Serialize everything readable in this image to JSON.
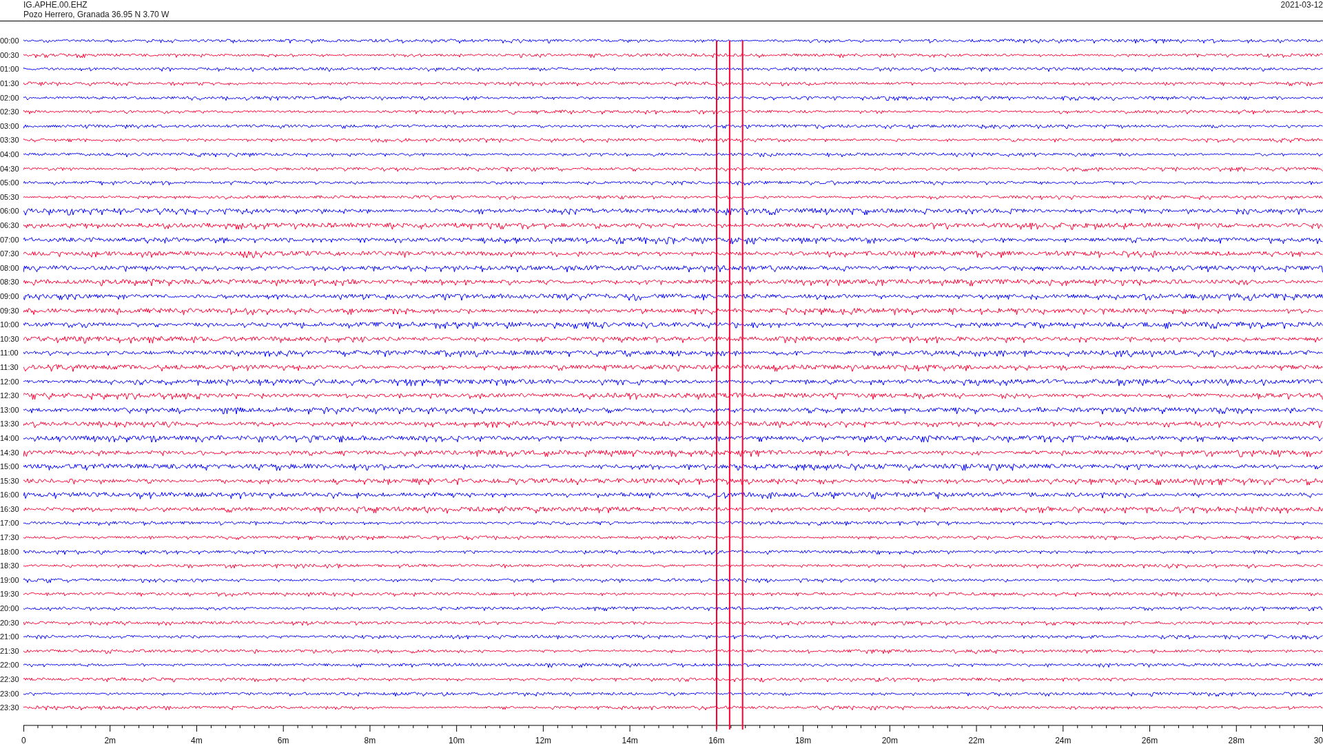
{
  "header": {
    "station": "IG.APHE.00.EHZ",
    "location": "Pozo Herrero, Granada  36.95 N 3.70 W",
    "date": "2021-03-12"
  },
  "rows": [
    {
      "label": "00:00",
      "color": "#0000ff"
    },
    {
      "label": "00:30",
      "color": "#ff0033"
    },
    {
      "label": "01:00",
      "color": "#0000ff"
    },
    {
      "label": "01:30",
      "color": "#ff0033"
    },
    {
      "label": "02:00",
      "color": "#0000ff"
    },
    {
      "label": "02:30",
      "color": "#ff0033"
    },
    {
      "label": "03:00",
      "color": "#0000ff"
    },
    {
      "label": "03:30",
      "color": "#ff0033"
    },
    {
      "label": "04:00",
      "color": "#0000ff"
    },
    {
      "label": "04:30",
      "color": "#ff0033"
    },
    {
      "label": "05:00",
      "color": "#0000ff"
    },
    {
      "label": "05:30",
      "color": "#ff0033"
    },
    {
      "label": "06:00",
      "color": "#0000ff"
    },
    {
      "label": "06:30",
      "color": "#ff0033"
    },
    {
      "label": "07:00",
      "color": "#0000ff"
    },
    {
      "label": "07:30",
      "color": "#ff0033"
    },
    {
      "label": "08:00",
      "color": "#0000ff"
    },
    {
      "label": "08:30",
      "color": "#ff0033"
    },
    {
      "label": "09:00",
      "color": "#0000ff"
    },
    {
      "label": "09:30",
      "color": "#ff0033"
    },
    {
      "label": "10:00",
      "color": "#0000ff"
    },
    {
      "label": "10:30",
      "color": "#ff0033"
    },
    {
      "label": "11:00",
      "color": "#0000ff"
    },
    {
      "label": "11:30",
      "color": "#ff0033"
    },
    {
      "label": "12:00",
      "color": "#0000ff"
    },
    {
      "label": "12:30",
      "color": "#ff0033"
    },
    {
      "label": "13:00",
      "color": "#0000ff"
    },
    {
      "label": "13:30",
      "color": "#ff0033"
    },
    {
      "label": "14:00",
      "color": "#0000ff"
    },
    {
      "label": "14:30",
      "color": "#ff0033"
    },
    {
      "label": "15:00",
      "color": "#0000ff"
    },
    {
      "label": "15:30",
      "color": "#ff0033"
    },
    {
      "label": "16:00",
      "color": "#0000ff"
    },
    {
      "label": "16:30",
      "color": "#ff0033"
    },
    {
      "label": "17:00",
      "color": "#0000ff"
    },
    {
      "label": "17:30",
      "color": "#ff0033"
    },
    {
      "label": "18:00",
      "color": "#0000ff"
    },
    {
      "label": "18:30",
      "color": "#ff0033"
    },
    {
      "label": "19:00",
      "color": "#0000ff"
    },
    {
      "label": "19:30",
      "color": "#ff0033"
    },
    {
      "label": "20:00",
      "color": "#0000ff"
    },
    {
      "label": "20:30",
      "color": "#ff0033"
    },
    {
      "label": "21:00",
      "color": "#0000ff"
    },
    {
      "label": "21:30",
      "color": "#ff0033"
    },
    {
      "label": "22:00",
      "color": "#0000ff"
    },
    {
      "label": "22:30",
      "color": "#ff0033"
    },
    {
      "label": "23:00",
      "color": "#0000ff"
    },
    {
      "label": "23:30",
      "color": "#ff0033"
    }
  ],
  "x_axis": {
    "ticks": [
      "0",
      "2m",
      "4m",
      "6m",
      "8m",
      "10m",
      "12m",
      "14m",
      "16m",
      "18m",
      "20m",
      "22m",
      "24m",
      "26m",
      "28m",
      "30"
    ]
  }
}
